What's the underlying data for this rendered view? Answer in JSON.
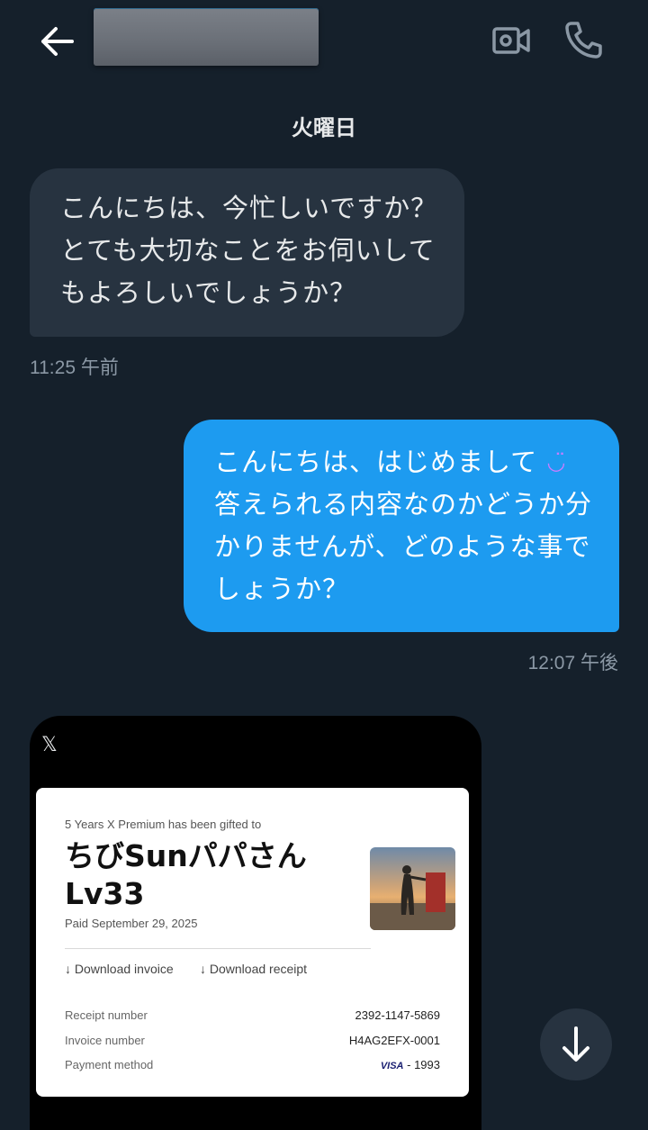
{
  "header": {
    "back_icon": "arrow-left-icon",
    "video_icon": "video-camera-icon",
    "call_icon": "phone-icon"
  },
  "conversation": {
    "day_label": "火曜日",
    "messages": [
      {
        "text": "こんにちは、今忙しいですか？\nとても大切なことをお伺いして\nもよろしいでしょうか？",
        "time": "11:25 午前"
      },
      {
        "text": "こんにちは、はじめまして",
        "emoji": "◡̈",
        "text2": "\n答えられる内容なのかどうか分\nかりませんが、どのような事で\nしょうか？",
        "time": "12:07 午後"
      }
    ]
  },
  "card": {
    "logo": "𝕏",
    "gift_line": "5 Years X Premium has been gifted to",
    "recipient": "ちびSunパパさん\nLv33",
    "paid": "Paid September 29, 2025",
    "download_invoice": "↓ Download invoice",
    "download_receipt": "↓ Download receipt",
    "rows": [
      {
        "label": "Receipt number",
        "value": "2392-1147-5869"
      },
      {
        "label": "Invoice number",
        "value": "H4AG2EFX-0001"
      },
      {
        "label": "Payment method",
        "brand": "VISA",
        "value": " - 1993"
      }
    ]
  },
  "scroll_icon": "arrow-down-icon"
}
